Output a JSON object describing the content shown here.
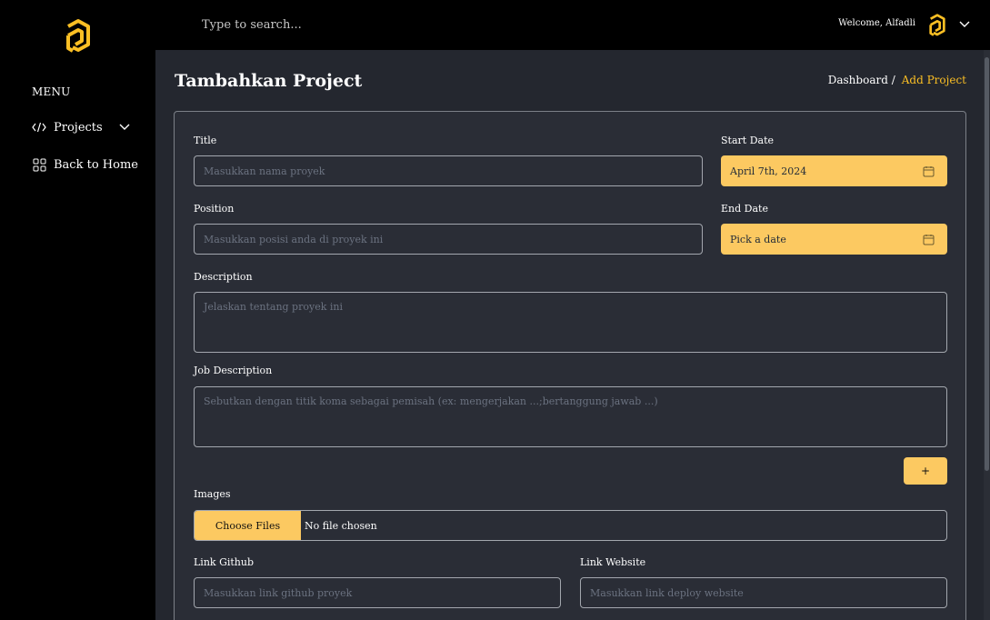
{
  "sidebar": {
    "menu_title": "MENU",
    "items": [
      {
        "label": "Projects",
        "icon": "code-icon"
      },
      {
        "label": "Back to Home",
        "icon": "grid-icon"
      }
    ]
  },
  "topbar": {
    "search_placeholder": "Type to search...",
    "welcome": "Welcome, Alfadli"
  },
  "page": {
    "title": "Tambahkan Project",
    "breadcrumb": {
      "parent": "Dashboard /",
      "current": "Add Project"
    }
  },
  "form": {
    "title_label": "Title",
    "title_placeholder": "Masukkan nama proyek",
    "start_date_label": "Start Date",
    "start_date_value": "April 7th, 2024",
    "position_label": "Position",
    "position_placeholder": "Masukkan posisi anda di proyek ini",
    "end_date_label": "End Date",
    "end_date_value": "Pick a date",
    "description_label": "Description",
    "description_placeholder": "Jelaskan tentang proyek ini",
    "job_description_label": "Job Description",
    "job_description_placeholder": "Sebutkan dengan titik koma sebagai pemisah (ex: mengerjakan ...;bertanggung jawab ...)",
    "add_button": "+",
    "images_label": "Images",
    "choose_files": "Choose Files",
    "no_file": "No file chosen",
    "github_label": "Link Github",
    "github_placeholder": "Masukkan link github proyek",
    "website_label": "Link Website",
    "website_placeholder": "Masukkan link deploy website"
  },
  "colors": {
    "accent": "#fcc961",
    "background": "#24272f",
    "sidebar": "#000000"
  }
}
